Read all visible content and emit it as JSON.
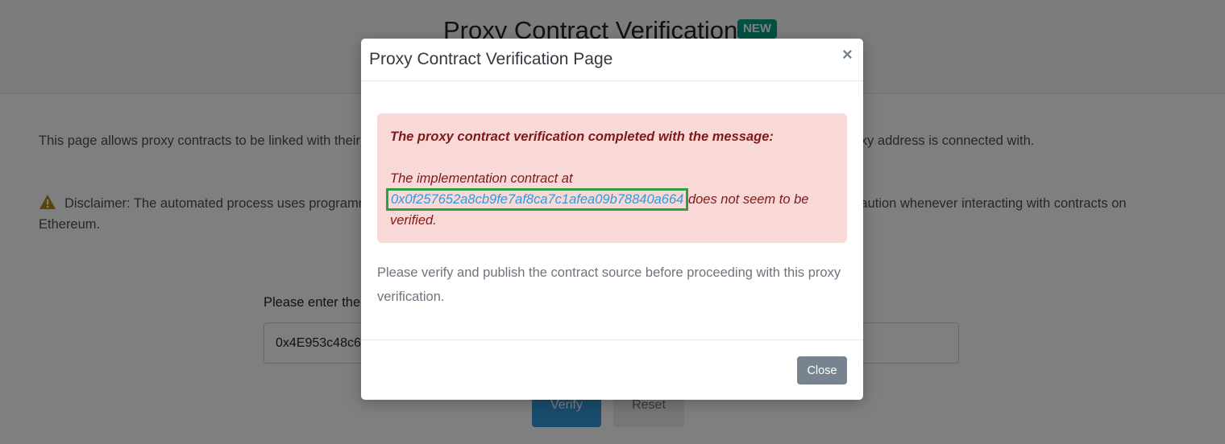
{
  "page": {
    "title": "Proxy Contract Verification",
    "badge": "NEW",
    "intro": "This page allows proxy contracts to be linked with their implementation contract, allowing users to interact and know which contract their proxy address is connected with.",
    "disclaimer": "Disclaimer: The automated process uses programmatic means to determine the implementation of the proxy contract. Please practice caution whenever interacting with contracts on Ethereum.",
    "field_label": "Please enter the Proxy Contract Address you would like to verify",
    "input_value": "0x4E953c48c6D1c3a1b2B2b5B67D8b6f2bB6d1c4a8",
    "verify_label": "Verify",
    "reset_label": "Reset",
    "warning_icon": "warning-triangle-icon"
  },
  "modal": {
    "title": "Proxy Contract Verification Page",
    "close_x": "×",
    "alert": {
      "heading": "The proxy contract verification completed with the message:",
      "line_prefix": "The implementation contract at",
      "address": "0x0f257652a8cb9fe7af8ca7c1afea09b78840a664",
      "line_suffix": "does not seem to be verified."
    },
    "body_text": "Please verify and publish the contract source before proceeding with this proxy verification.",
    "close_label": "Close"
  },
  "colors": {
    "badge": "#00a186",
    "alert_bg": "#f8d9d7",
    "alert_text": "#7d1a1a",
    "link": "#3498db",
    "highlight": "#2ea043",
    "close_button": "#77838f"
  }
}
